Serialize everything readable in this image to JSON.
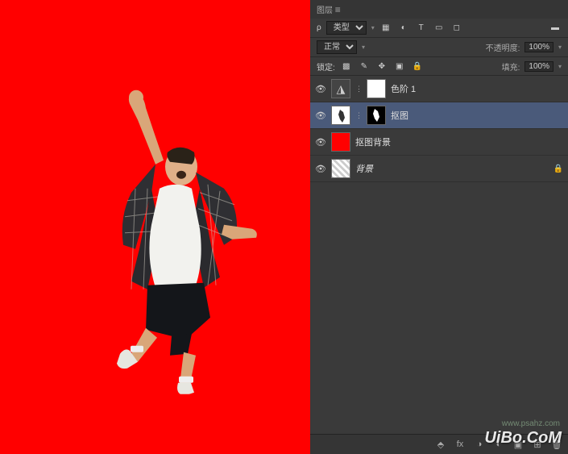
{
  "panel": {
    "title": "图层",
    "filterPrefix": "ρ",
    "filterKind": "类型",
    "blendMode": "正常",
    "opacityLabel": "不透明度:",
    "opacityValue": "100%",
    "lockLabel": "锁定:",
    "fillLabel": "填充:",
    "fillValue": "100%"
  },
  "layers": [
    {
      "name": "色阶 1",
      "hasAdj": true,
      "hasMask": true,
      "selected": false,
      "locked": false
    },
    {
      "name": "抠图",
      "hasThumb": "cutout",
      "hasMask": "silhouette",
      "selected": true,
      "locked": false
    },
    {
      "name": "抠图背景",
      "hasThumb": "red",
      "selected": false,
      "locked": false
    },
    {
      "name": "背景",
      "hasThumb": "trans",
      "selected": false,
      "locked": true,
      "italic": true
    }
  ],
  "watermark": {
    "main": "UiBo.CoM",
    "sub": "www.psahz.com"
  },
  "icons": {
    "eye": "eye-icon",
    "lock": "lock-icon"
  }
}
